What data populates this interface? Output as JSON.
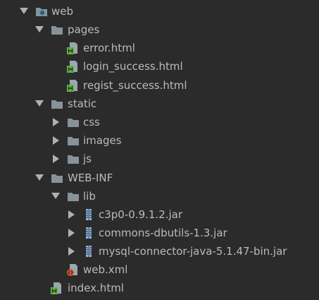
{
  "tree": {
    "web": {
      "label": "web",
      "icon": "web-folder-icon",
      "expanded": true
    },
    "pages": {
      "label": "pages",
      "icon": "folder-icon",
      "expanded": true
    },
    "error": {
      "label": "error.html",
      "icon": "html-file-icon"
    },
    "login_success": {
      "label": "login_success.html",
      "icon": "html-file-icon"
    },
    "regist_success": {
      "label": "regist_success.html",
      "icon": "html-file-icon"
    },
    "static": {
      "label": "static",
      "icon": "folder-icon",
      "expanded": true
    },
    "css": {
      "label": "css",
      "icon": "folder-icon",
      "expanded": false
    },
    "images": {
      "label": "images",
      "icon": "folder-icon",
      "expanded": false
    },
    "js": {
      "label": "js",
      "icon": "folder-icon",
      "expanded": false
    },
    "web_inf": {
      "label": "WEB-INF",
      "icon": "folder-icon",
      "expanded": true
    },
    "lib": {
      "label": "lib",
      "icon": "folder-icon",
      "expanded": true
    },
    "c3p0": {
      "label": "c3p0-0.9.1.2.jar",
      "icon": "jar-icon",
      "expanded": false
    },
    "dbutils": {
      "label": "commons-dbutils-1.3.jar",
      "icon": "jar-icon",
      "expanded": false
    },
    "mysql": {
      "label": "mysql-connector-java-5.1.47-bin.jar",
      "icon": "jar-icon",
      "expanded": false
    },
    "web_xml": {
      "label": "web.xml",
      "icon": "xml-file-icon"
    },
    "index": {
      "label": "index.html",
      "icon": "html-file-icon"
    }
  },
  "colors": {
    "background": "#2b2b2b",
    "text": "#bbbbbb",
    "arrow": "#afb1b3",
    "folder": "#87939a",
    "html_badge": "#62b543",
    "jar": "#8fb6e0",
    "web_badge": "#3592c4",
    "xml_badge": "#d9572c"
  }
}
